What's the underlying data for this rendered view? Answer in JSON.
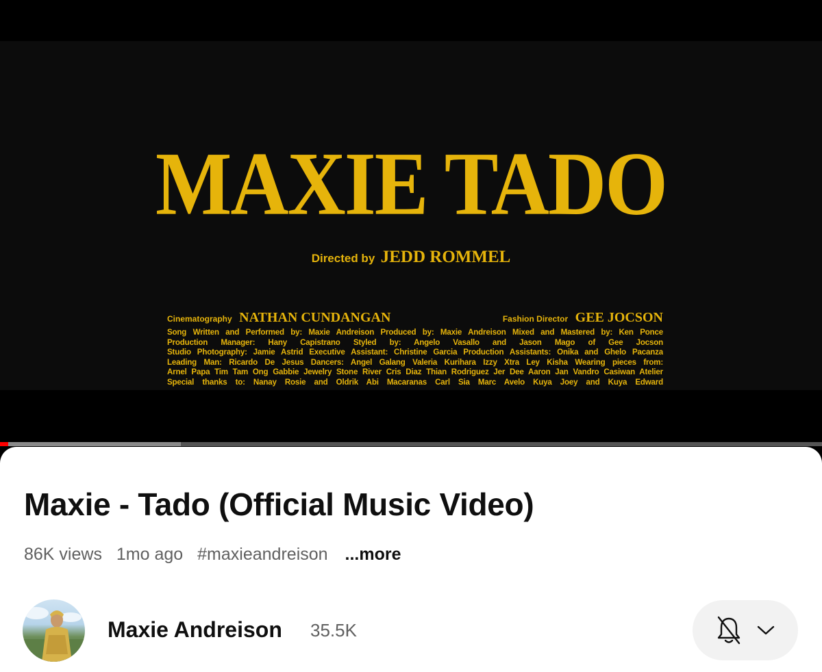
{
  "video_frame": {
    "title": "MAXIE TADO",
    "directed_label": "Directed by",
    "director": "JEDD ROMMEL",
    "cinematography_label": "Cinematography",
    "cinematographer": "NATHAN CUNDANGAN",
    "fashion_label": "Fashion Director",
    "fashion_director": "GEE JOCSON",
    "credit_lines": [
      "Song Written and Performed by: Maxie Andreison Produced by: Maxie Andreison Mixed and Mastered by: Ken Ponce",
      "Production Manager: Hany Capistrano Styled by: Angelo Vasallo and Jason Mago of Gee Jocson",
      "Studio Photography: Jamie Astrid Executive Assistant: Christine Garcia Production Assistants: Onika and Ghelo Pacanza",
      "Leading Man: Ricardo De Jesus Dancers: Angel Galang Valeria Kurihara Izzy Xtra Ley Kisha Wearing pieces from:",
      "Arnel Papa Tim Tam Ong Gabbie Jewelry Stone River Cris Diaz Thian Rodriguez Jer Dee Aaron Jan Vandro Casiwan Atelier",
      "Special thanks to: Nanay Rosie and Oldrik Abi Macaranas Carl Sia Marc Avelo Kuya Joey and Kuya Edward"
    ]
  },
  "progress": {
    "played_fraction": 0.01,
    "buffered_fraction": 0.22
  },
  "video": {
    "title": "Maxie - Tado (Official Music Video)",
    "views": "86K views",
    "age": "1mo ago",
    "hashtag": "#maxieandreison",
    "more": "...more"
  },
  "channel": {
    "name": "Maxie Andreison",
    "subscribers": "35.5K",
    "avatar_icon": "channel-avatar"
  },
  "subscribe_button": {
    "icon": "bell-off-icon",
    "chevron": "chevron-down-icon"
  },
  "colors": {
    "credit_gold": "#e6b40b",
    "progress_red": "#ff0000"
  }
}
